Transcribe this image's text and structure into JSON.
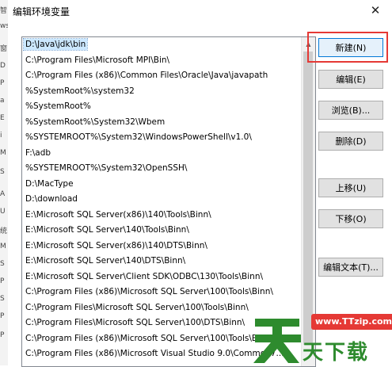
{
  "window": {
    "title": "编辑环境变量",
    "close_glyph": "✕"
  },
  "background_window": {
    "glyph_fragments": [
      "智",
      "ws",
      "窗",
      "D",
      "P",
      "a",
      "E",
      "i",
      "M",
      "S",
      "A",
      "U",
      "统",
      "M",
      "S",
      "P",
      "S",
      "P",
      "P"
    ]
  },
  "path_list": {
    "items": [
      "D:\\Java\\jdk\\bin",
      "C:\\Program Files\\Microsoft MPI\\Bin\\",
      "C:\\Program Files (x86)\\Common Files\\Oracle\\Java\\javapath",
      "%SystemRoot%\\system32",
      "%SystemRoot%",
      "%SystemRoot%\\System32\\Wbem",
      "%SYSTEMROOT%\\System32\\WindowsPowerShell\\v1.0\\",
      "F:\\adb",
      "%SYSTEMROOT%\\System32\\OpenSSH\\",
      "D:\\MacType",
      "D:\\download",
      "E:\\Microsoft SQL Server(x86)\\140\\Tools\\Binn\\",
      "E:\\Microsoft SQL Server\\140\\Tools\\Binn\\",
      "E:\\Microsoft SQL Server(x86)\\140\\DTS\\Binn\\",
      "E:\\Microsoft SQL Server\\140\\DTS\\Binn\\",
      "E:\\Microsoft SQL Server\\Client SDK\\ODBC\\130\\Tools\\Binn\\",
      "C:\\Program Files (x86)\\Microsoft SQL Server\\100\\Tools\\Binn\\",
      "C:\\Program Files\\Microsoft SQL Server\\100\\Tools\\Binn\\",
      "C:\\Program Files\\Microsoft SQL Server\\100\\DTS\\Binn\\",
      "C:\\Program Files (x86)\\Microsoft SQL Server\\100\\Tools\\Bin",
      "C:\\Program Files (x86)\\Microsoft Visual Studio 9.0\\Common7..."
    ],
    "selected_index": 0
  },
  "buttons": {
    "new": "新建(N)",
    "edit": "编辑(E)",
    "browse": "浏览(B)...",
    "delete": "删除(D)",
    "move_up": "上移(U)",
    "move_down": "下移(O)",
    "edit_text": "编辑文本(T)..."
  },
  "watermark": {
    "url": "www.TTzip.com",
    "text": "天下载"
  },
  "colors": {
    "selection": "#cce8ff",
    "highlight_border": "#e53935",
    "watermark_green": "#2e8b2e",
    "watermark_red": "#e53935"
  }
}
